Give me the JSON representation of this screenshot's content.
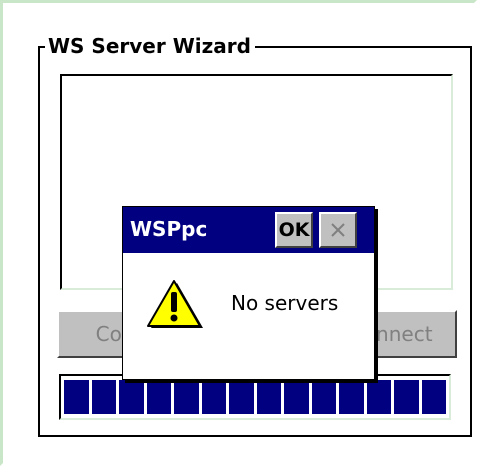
{
  "wizard": {
    "title": "WS Server Wizard",
    "left_button_label": "Connect",
    "right_button_label": "Disconnect",
    "progress_fraction": 1.0,
    "progress_segments": 14
  },
  "message_box": {
    "title": "WSPpc",
    "ok_label": "OK",
    "close_label": "×",
    "text": "No servers",
    "icon": "warning-icon"
  },
  "colors": {
    "titlebar": "#000080",
    "progress": "#000080",
    "button_face": "#c0c0c0",
    "frame_accent": "#c9e6c9"
  }
}
